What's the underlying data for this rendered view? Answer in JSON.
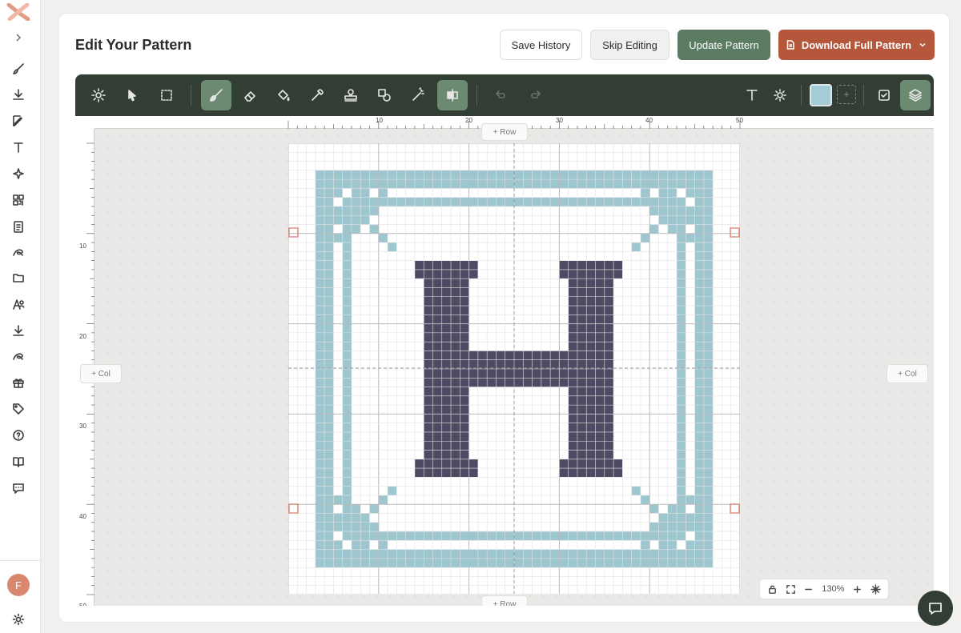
{
  "header": {
    "title": "Edit Your Pattern",
    "save_history": "Save History",
    "skip_editing": "Skip Editing",
    "update_pattern": "Update Pattern",
    "download_full_pattern": "Download Full Pattern"
  },
  "sidebar": {
    "avatar_initial": "F",
    "items": [
      "brush-icon",
      "download-icon",
      "edit-icon",
      "text-icon",
      "sparkle-icon",
      "qr-icon",
      "clipboard-icon",
      "thread-icon",
      "folder-icon",
      "users-icon",
      "download-icon",
      "thread-icon",
      "gift-icon",
      "tag-icon",
      "help-icon",
      "book-icon",
      "message-icon"
    ]
  },
  "toolbar": {
    "tools": [
      "settings",
      "select",
      "marquee",
      "brush",
      "eraser",
      "fill",
      "eyedropper",
      "stamp",
      "shapes",
      "magic-wand",
      "mirror",
      "undo",
      "redo",
      "text",
      "sun"
    ],
    "active_tools": [
      "brush",
      "mirror"
    ],
    "current_color": "#a4ccd6",
    "add_color_label": "+"
  },
  "canvas": {
    "add_row_label": "+ Row",
    "add_col_label": "+ Col",
    "ruler_top": [
      "10",
      "20",
      "30",
      "40",
      "50"
    ],
    "ruler_left": [
      "10",
      "20",
      "30",
      "40",
      "50"
    ],
    "zoom": "130%"
  },
  "pattern": {
    "grid_size": 50,
    "border_color": "#9ec6cf",
    "letter": "H",
    "letter_color": "#4d4a63"
  }
}
